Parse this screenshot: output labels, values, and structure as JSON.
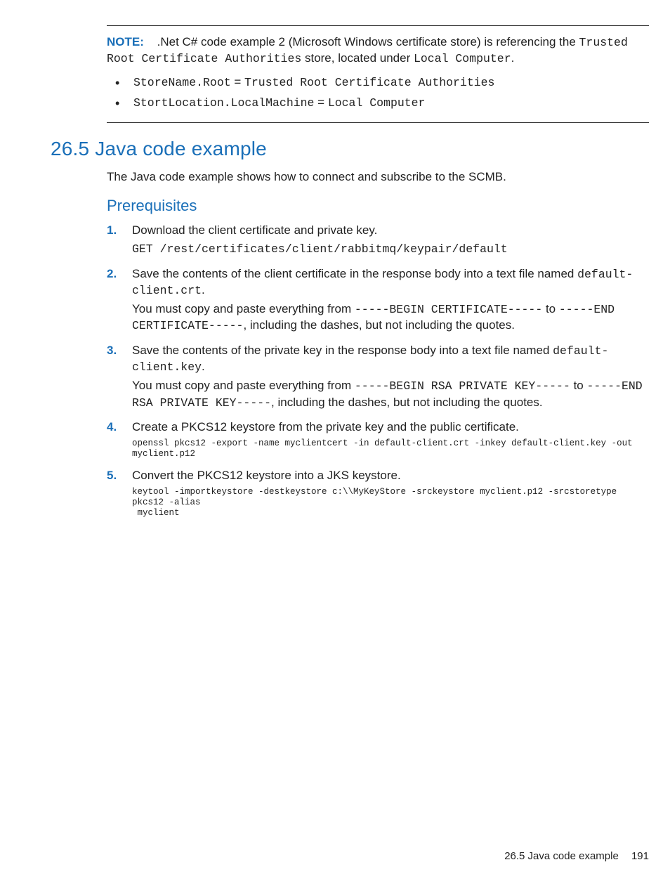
{
  "note": {
    "label": "NOTE:",
    "p1_a": ".Net C# code example 2 (Microsoft Windows certificate store) is referencing the ",
    "p1_m1": "Trusted Root Certificate Authorities",
    "p1_b": " store, located under ",
    "p1_m2": "Local Computer",
    "p1_c": ".",
    "li1_m1": "StoreName.Root",
    "li1_eq": " = ",
    "li1_m2": "Trusted Root Certificate Authorities",
    "li2_m1": "StortLocation.LocalMachine",
    "li2_eq": " = ",
    "li2_m2": "Local Computer"
  },
  "section": {
    "title": "26.5 Java code example",
    "intro": "The Java code example shows how to connect and subscribe to the SCMB.",
    "prereq": "Prerequisites"
  },
  "steps": {
    "s1a": "Download the client certificate and private key.",
    "s1m": "GET /rest/certificates/client/rabbitmq/keypair/default",
    "s2a": "Save the contents of the client certificate in the response body into a text file named ",
    "s2m1": "default-client.crt",
    "s2b": ".",
    "s2c": "You must copy and paste everything from ",
    "s2m2": "-----BEGIN CERTIFICATE-----",
    "s2d": " to ",
    "s2m3": "-----END CERTIFICATE-----",
    "s2e": ", including the dashes, but not including the quotes.",
    "s3a": "Save the contents of the private key in the response body into a text file named ",
    "s3m1": "default-client.key",
    "s3b": ".",
    "s3c": "You must copy and paste everything from ",
    "s3m2": "-----BEGIN RSA PRIVATE KEY-----",
    "s3d": " to ",
    "s3m3": "-----END RSA PRIVATE KEY-----",
    "s3e": ", including the dashes, but not including the quotes.",
    "s4a": "Create a PKCS12 keystore from the private key and the public certificate.",
    "s4cmd": "openssl pkcs12 -export -name myclientcert -in default-client.crt -inkey default-client.key -out myclient.p12",
    "s5a": "Convert the PKCS12 keystore into a JKS keystore.",
    "s5cmd": "keytool -importkeystore -destkeystore c:\\\\MyKeyStore -srckeystore myclient.p12 -srcstoretype pkcs12 -alias\n myclient"
  },
  "footer": {
    "title": "26.5 Java code example",
    "page": "191"
  }
}
